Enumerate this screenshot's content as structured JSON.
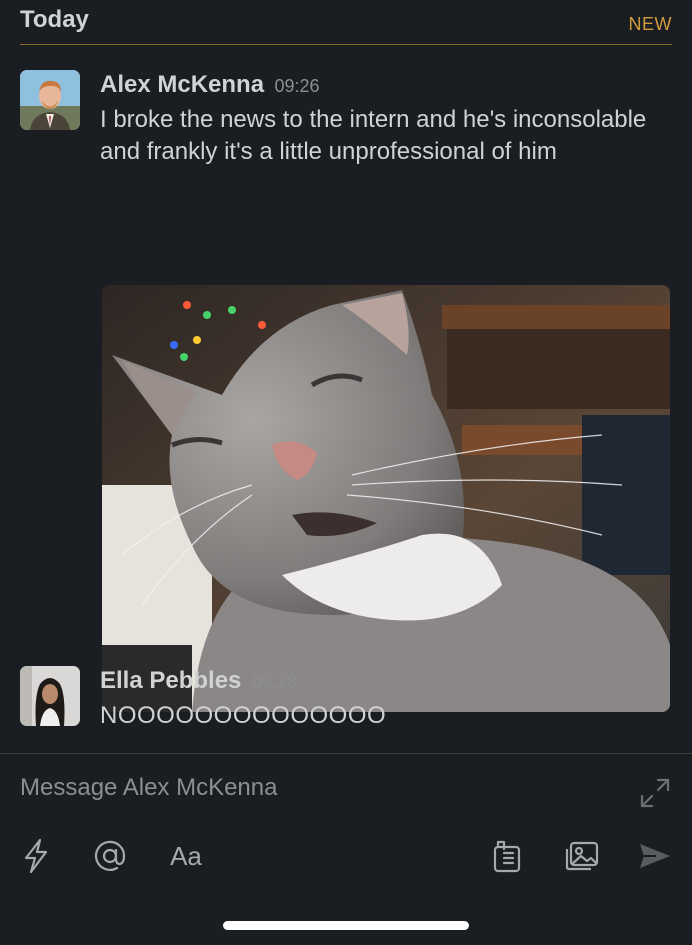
{
  "day_header": {
    "label": "Today",
    "new_label": "NEW"
  },
  "messages": [
    {
      "author": "Alex McKenna",
      "time": "09:26",
      "text": "I broke the news to the intern and he's inconsolable and frankly it's a little unprofessional of him",
      "attachment": "photo"
    },
    {
      "author": "Ella Pebbles",
      "time": "09:28",
      "text": "NOOOOOOOOOOOOOO"
    }
  ],
  "composer": {
    "placeholder": "Message Alex McKenna",
    "format_label": "Aa"
  },
  "colors": {
    "background": "#1a1d21",
    "new_divider": "#d29b3c",
    "text": "#d1d2d3",
    "muted": "#8c8e91"
  },
  "icons": [
    "lightning-icon",
    "at-icon",
    "files-icon",
    "photo-icon",
    "send-icon",
    "expand-icon"
  ]
}
